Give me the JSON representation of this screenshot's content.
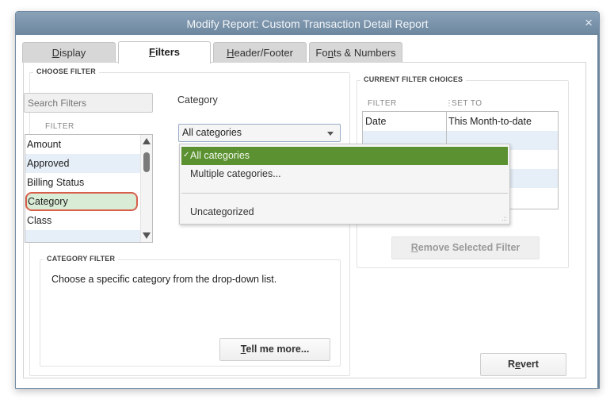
{
  "window": {
    "title": "Modify Report: Custom Transaction Detail Report",
    "close_label": "×"
  },
  "tabs": [
    {
      "label_pre": "",
      "label_u": "D",
      "label_post": "isplay",
      "active": false
    },
    {
      "label_pre": "",
      "label_u": "F",
      "label_post": "ilters",
      "active": true
    },
    {
      "label_pre": "",
      "label_u": "H",
      "label_post": "eader/Footer",
      "active": false
    },
    {
      "label_pre": "Fo",
      "label_u": "n",
      "label_post": "ts & Numbers",
      "active": false
    }
  ],
  "choose_filter": {
    "group_label": "CHOOSE FILTER",
    "search_placeholder": "Search Filters",
    "filter_col_header": "FILTER",
    "filters": [
      "Amount",
      "Approved",
      "Billing Status",
      "Category",
      "Class",
      ""
    ],
    "selected_filter": "Category",
    "category_label": "Category",
    "combo_value": "All categories",
    "dropdown_options": [
      {
        "label": "All categories",
        "checked": true,
        "check_mark": "✓"
      },
      {
        "label": "Multiple categories...",
        "checked": false
      },
      {
        "label": "Uncategorized",
        "checked": false
      }
    ]
  },
  "category_filter": {
    "group_label": "CATEGORY FILTER",
    "description": "Choose a specific category from the drop-down list.",
    "tell_me_more_u": "T",
    "tell_me_more_rest": "ell me more..."
  },
  "current_filter_choices": {
    "group_label": "CURRENT FILTER CHOICES",
    "col_filter": "FILTER",
    "col_set_to": "SET TO",
    "rows": [
      {
        "filter": "Date",
        "set_to": "This Month-to-date"
      },
      {
        "filter": "",
        "set_to": ""
      },
      {
        "filter": "",
        "set_to": ""
      },
      {
        "filter": "",
        "set_to": ""
      },
      {
        "filter": "",
        "set_to": ""
      }
    ],
    "remove_u": "R",
    "remove_rest": "emove Selected Filter"
  },
  "footer": {
    "revert_pre": "R",
    "revert_u": "e",
    "revert_post": "vert"
  }
}
